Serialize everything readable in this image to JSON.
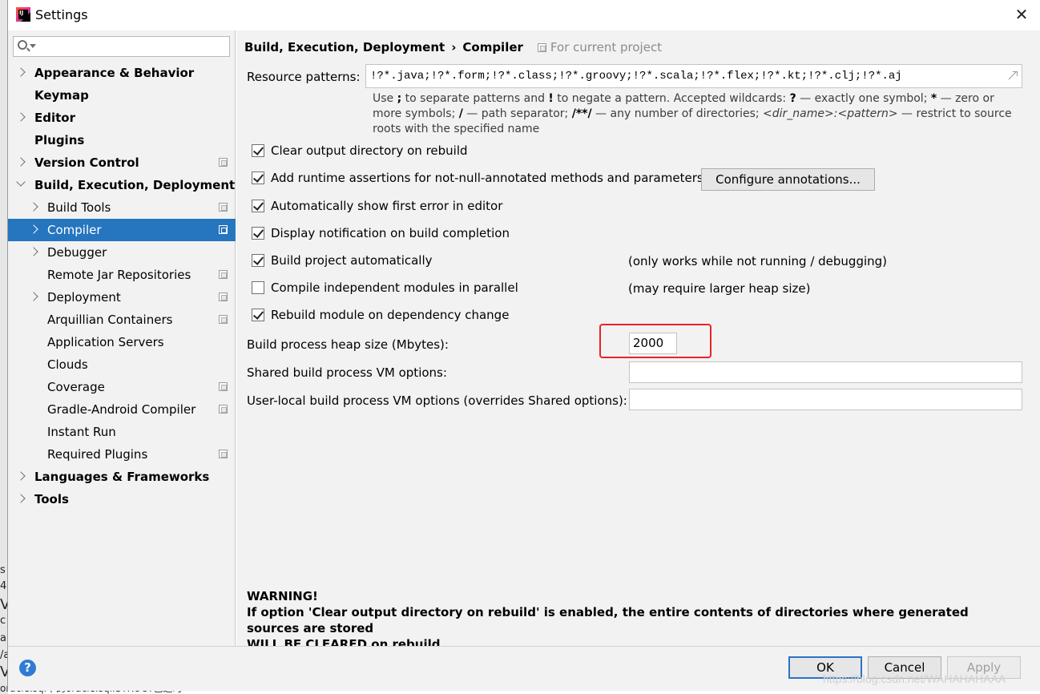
{
  "window": {
    "title": "Settings",
    "close_glyph": "✕"
  },
  "sidebar": {
    "search_value": "",
    "items": [
      {
        "label": "Appearance & Behavior",
        "level": 0,
        "bold": true,
        "expander": "collapsed",
        "project_icon": false,
        "selected": false
      },
      {
        "label": "Keymap",
        "level": 0,
        "bold": true,
        "expander": "none",
        "project_icon": false,
        "selected": false
      },
      {
        "label": "Editor",
        "level": 0,
        "bold": true,
        "expander": "collapsed",
        "project_icon": false,
        "selected": false
      },
      {
        "label": "Plugins",
        "level": 0,
        "bold": true,
        "expander": "none",
        "project_icon": false,
        "selected": false
      },
      {
        "label": "Version Control",
        "level": 0,
        "bold": true,
        "expander": "collapsed",
        "project_icon": true,
        "selected": false
      },
      {
        "label": "Build, Execution, Deployment",
        "level": 0,
        "bold": true,
        "expander": "expanded",
        "project_icon": false,
        "selected": false
      },
      {
        "label": "Build Tools",
        "level": 1,
        "bold": false,
        "expander": "collapsed",
        "project_icon": true,
        "selected": false
      },
      {
        "label": "Compiler",
        "level": 1,
        "bold": false,
        "expander": "collapsed",
        "project_icon": true,
        "selected": true
      },
      {
        "label": "Debugger",
        "level": 1,
        "bold": false,
        "expander": "collapsed",
        "project_icon": false,
        "selected": false
      },
      {
        "label": "Remote Jar Repositories",
        "level": 1,
        "bold": false,
        "expander": "none",
        "project_icon": true,
        "selected": false
      },
      {
        "label": "Deployment",
        "level": 1,
        "bold": false,
        "expander": "collapsed",
        "project_icon": true,
        "selected": false
      },
      {
        "label": "Arquillian Containers",
        "level": 1,
        "bold": false,
        "expander": "none",
        "project_icon": true,
        "selected": false
      },
      {
        "label": "Application Servers",
        "level": 1,
        "bold": false,
        "expander": "none",
        "project_icon": false,
        "selected": false
      },
      {
        "label": "Clouds",
        "level": 1,
        "bold": false,
        "expander": "none",
        "project_icon": false,
        "selected": false
      },
      {
        "label": "Coverage",
        "level": 1,
        "bold": false,
        "expander": "none",
        "project_icon": true,
        "selected": false
      },
      {
        "label": "Gradle-Android Compiler",
        "level": 1,
        "bold": false,
        "expander": "none",
        "project_icon": true,
        "selected": false
      },
      {
        "label": "Instant Run",
        "level": 1,
        "bold": false,
        "expander": "none",
        "project_icon": false,
        "selected": false
      },
      {
        "label": "Required Plugins",
        "level": 1,
        "bold": false,
        "expander": "none",
        "project_icon": true,
        "selected": false
      },
      {
        "label": "Languages & Frameworks",
        "level": 0,
        "bold": true,
        "expander": "collapsed",
        "project_icon": false,
        "selected": false
      },
      {
        "label": "Tools",
        "level": 0,
        "bold": true,
        "expander": "collapsed",
        "project_icon": false,
        "selected": false
      }
    ]
  },
  "breadcrumb": {
    "parent": "Build, Execution, Deployment",
    "separator": "›",
    "current": "Compiler",
    "scope": "For current project"
  },
  "resource": {
    "label": "Resource patterns:",
    "value": "!?*.java;!?*.form;!?*.class;!?*.groovy;!?*.scala;!?*.flex;!?*.kt;!?*.clj;!?*.aj",
    "hint": [
      "Use ",
      ";",
      " to separate patterns and ",
      "!",
      " to negate a pattern. Accepted wildcards: ",
      "?",
      " — exactly one symbol; ",
      "*",
      " — zero or more symbols; ",
      "/",
      " — path separator; ",
      "/**/",
      " — any number of directories; ",
      "<dir_name>:<pattern>",
      " — restrict to source roots with the specified name"
    ]
  },
  "options": [
    {
      "label": "Clear output directory on rebuild",
      "checked": true,
      "note": ""
    },
    {
      "label": "Add runtime assertions for not-null-annotated methods and parameters",
      "checked": true,
      "note": ""
    },
    {
      "label": "Automatically show first error in editor",
      "checked": true,
      "note": ""
    },
    {
      "label": "Display notification on build completion",
      "checked": true,
      "note": ""
    },
    {
      "label": "Build project automatically",
      "checked": true,
      "note": "(only works while not running / debugging)"
    },
    {
      "label": "Compile independent modules in parallel",
      "checked": false,
      "note": "(may require larger heap size)"
    },
    {
      "label": "Rebuild module on dependency change",
      "checked": true,
      "note": ""
    }
  ],
  "configure_button": "Configure annotations...",
  "heap": {
    "label": "Build process heap size (Mbytes):",
    "value": "2000"
  },
  "shared_vm": {
    "label": "Shared build process VM options:",
    "value": ""
  },
  "local_vm": {
    "label": "User-local build process VM options (overrides Shared options):",
    "value": ""
  },
  "warning": {
    "line1": "WARNING!",
    "line2": "If option 'Clear output directory on rebuild' is enabled, the entire contents of directories where generated sources are stored",
    "line3": "WILL BE CLEARED on rebuild."
  },
  "footer": {
    "help_glyph": "?",
    "ok": "OK",
    "cancel": "Cancel",
    "apply": "Apply",
    "watermark": "https://blog.csdn.net/WAHAHAHAAA"
  },
  "background": {
    "fragments": [
      "s",
      "4:",
      "V",
      "c",
      "a:",
      "/a",
      "V"
    ],
    "bottom_text": "oracle.sql中的oracle.sql.STRUCT已过时"
  },
  "colors": {
    "selection": "#2675bf",
    "highlight_box": "#e8232a",
    "panel_bg": "#f2f2f2",
    "ok_border": "#2c73c7",
    "help_icon": "#2f7bd6"
  }
}
